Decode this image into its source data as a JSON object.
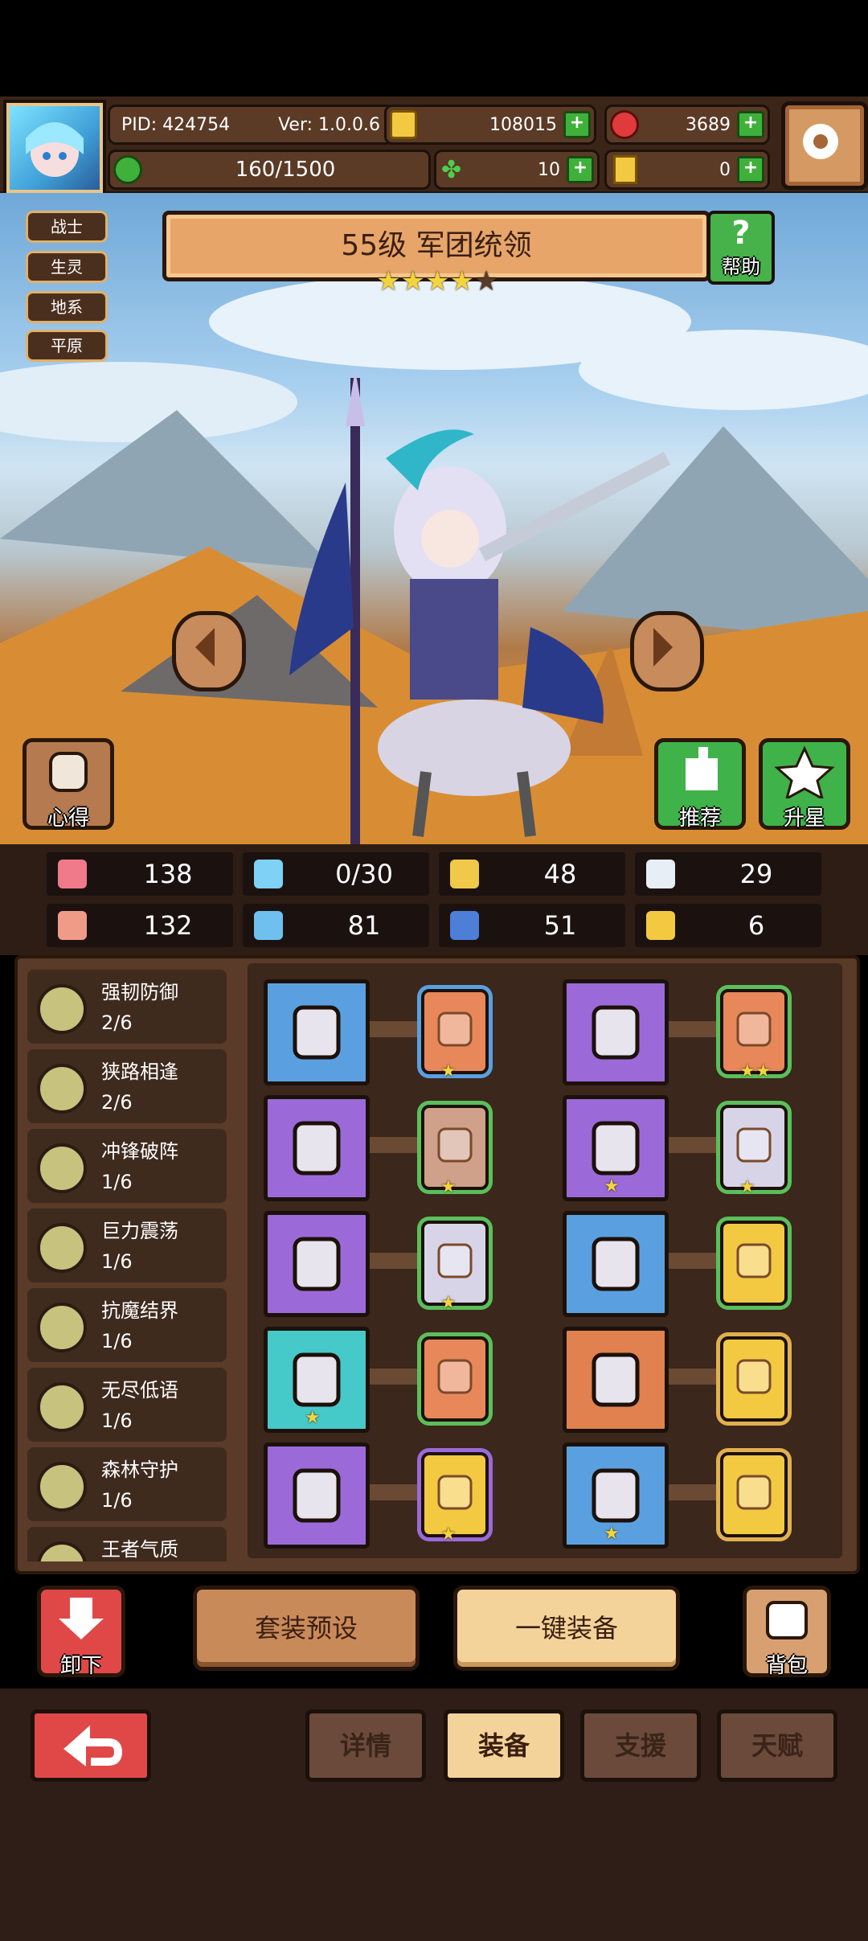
{
  "header": {
    "pid": "PID: 424754",
    "version": "Ver: 1.0.0.6",
    "gold": "108015",
    "gems": "3689",
    "stamina": "160/1500",
    "clover": "10",
    "key": "0"
  },
  "hero": {
    "tags": [
      "战士",
      "生灵",
      "地系",
      "平原"
    ],
    "title": "55级 军团统领",
    "stars": 4,
    "help_label": "帮助",
    "notes_label": "心得",
    "recommend_label": "推荐",
    "upstar_label": "升星"
  },
  "stats": [
    {
      "icon": "heart-icon",
      "value": "138",
      "color": "#f07a8a"
    },
    {
      "icon": "water-drop-icon",
      "value": "0/30",
      "color": "#7fd1f5"
    },
    {
      "icon": "shield-icon",
      "value": "48",
      "color": "#f0c84a"
    },
    {
      "icon": "wing-icon",
      "value": "29",
      "color": "#e8eef5"
    },
    {
      "icon": "fist-icon",
      "value": "132",
      "color": "#f09a88"
    },
    {
      "icon": "book-icon",
      "value": "81",
      "color": "#6fc0ef"
    },
    {
      "icon": "scroll-icon",
      "value": "51",
      "color": "#4d7fd9"
    },
    {
      "icon": "horseshoe-icon",
      "value": "6",
      "color": "#f3c942"
    }
  ],
  "sets": [
    {
      "name": "强韧防御",
      "progress": "2/6"
    },
    {
      "name": "狭路相逢",
      "progress": "2/6"
    },
    {
      "name": "冲锋破阵",
      "progress": "1/6"
    },
    {
      "name": "巨力震荡",
      "progress": "1/6"
    },
    {
      "name": "抗魔结界",
      "progress": "1/6"
    },
    {
      "name": "无尽低语",
      "progress": "1/6"
    },
    {
      "name": "森林守护",
      "progress": "1/6"
    },
    {
      "name": "王者气质",
      "progress": ""
    }
  ],
  "equipment": [
    {
      "item": "sword-icon",
      "item_bg": "#5aa0e0",
      "item_stars": "",
      "card_bg": "#e8885a",
      "card_border": "#5aa0e0",
      "card_stars": "★"
    },
    {
      "item": "helmet-icon",
      "item_bg": "#9b6ad8",
      "item_stars": "",
      "card_bg": "#e8885a",
      "card_border": "#5bbf5b",
      "card_stars": "★★"
    },
    {
      "item": "wooden-armor-icon",
      "item_bg": "#9b6ad8",
      "item_stars": "",
      "card_bg": "#cfa08a",
      "card_border": "#5bbf5b",
      "card_stars": "★"
    },
    {
      "item": "bone-icon",
      "item_bg": "#9b6ad8",
      "item_stars": "★",
      "card_bg": "#d8d4e8",
      "card_border": "#5bbf5b",
      "card_stars": "★"
    },
    {
      "item": "heart-necklace-icon",
      "item_bg": "#9b6ad8",
      "item_stars": "",
      "card_bg": "#d8d4e8",
      "card_border": "#5bbf5b",
      "card_stars": "★"
    },
    {
      "item": "gauntlet-icon",
      "item_bg": "#5aa0e0",
      "item_stars": "",
      "card_bg": "#f3c942",
      "card_border": "#5bbf5b",
      "card_stars": ""
    },
    {
      "item": "crystal-orb-icon",
      "item_bg": "#46c9c9",
      "item_stars": "★",
      "card_bg": "#e8885a",
      "card_border": "#5bbf5b",
      "card_stars": ""
    },
    {
      "item": "crown-icon",
      "item_bg": "#e0814f",
      "item_stars": "",
      "card_bg": "#f3c942",
      "card_border": "#e0b050",
      "card_stars": ""
    },
    {
      "item": "dark-helm-icon",
      "item_bg": "#9b6ad8",
      "item_stars": "",
      "card_bg": "#f3c942",
      "card_border": "#9b6ad8",
      "card_stars": "★"
    },
    {
      "item": "boots-icon",
      "item_bg": "#5aa0e0",
      "item_stars": "★",
      "card_bg": "#f3c942",
      "card_border": "#e0b050",
      "card_stars": ""
    }
  ],
  "actions": {
    "unequip": "卸下",
    "preset": "套装预设",
    "equip_all": "一键装备",
    "bag": "背包"
  },
  "tabs": [
    "详情",
    "装备",
    "支援",
    "天赋"
  ]
}
